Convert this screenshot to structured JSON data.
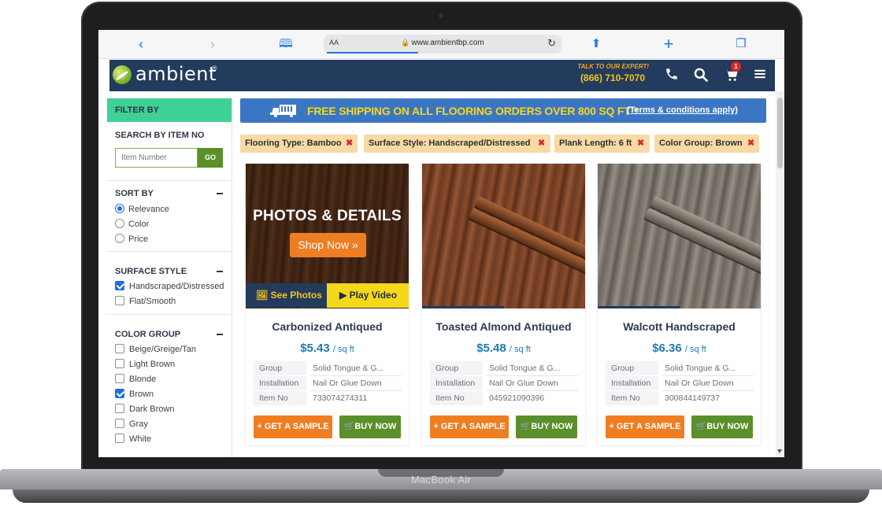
{
  "device": {
    "label": "MacBook Air"
  },
  "browser": {
    "url": "www.ambientbp.com",
    "aa_label": "AA"
  },
  "header": {
    "logo_text": "ambient",
    "logo_reg": "®",
    "expert_label": "TALK TO OUR EXPERT!",
    "phone": "(866) 710-7070",
    "cart_count": "1"
  },
  "sidebar": {
    "filter_title": "FILTER BY",
    "search": {
      "title": "SEARCH BY ITEM NO",
      "placeholder": "Item Number",
      "go_label": "GO"
    },
    "sort": {
      "title": "SORT BY",
      "options": [
        {
          "label": "Relevance",
          "selected": true
        },
        {
          "label": "Color",
          "selected": false
        },
        {
          "label": "Price",
          "selected": false
        }
      ]
    },
    "surface": {
      "title": "SURFACE STYLE",
      "options": [
        {
          "label": "Handscraped/Distressed",
          "checked": true
        },
        {
          "label": "Flat/Smooth",
          "checked": false
        }
      ]
    },
    "color": {
      "title": "COLOR GROUP",
      "options": [
        {
          "label": "Beige/Greige/Tan",
          "checked": false
        },
        {
          "label": "Light Brown",
          "checked": false
        },
        {
          "label": "Blonde",
          "checked": false
        },
        {
          "label": "Brown",
          "checked": true
        },
        {
          "label": "Dark Brown",
          "checked": false
        },
        {
          "label": "Gray",
          "checked": false
        },
        {
          "label": "White",
          "checked": false
        }
      ]
    }
  },
  "banner": {
    "text": "FREE SHIPPING ON ALL FLOORING ORDERS OVER 800 SQ FT *",
    "link": "(Terms & conditions apply)"
  },
  "chips": [
    {
      "label": "Flooring Type: Bamboo"
    },
    {
      "label": "Surface Style: Handscraped/Distressed"
    },
    {
      "label": "Plank Length: 6 ft"
    },
    {
      "label": "Color Group: Brown"
    }
  ],
  "promo": {
    "title": "PHOTOS & DETAILS",
    "shop_now": "Shop Now »",
    "see_photos": "See Photos",
    "play_video": "Play Video"
  },
  "products": [
    {
      "name": "Carbonized Antiqued",
      "price": "$5.43",
      "unit": "/ sq ft",
      "specs": [
        {
          "k": "Group",
          "v": "Solid Tongue & G..."
        },
        {
          "k": "Installation",
          "v": "Nail Or Glue Down"
        },
        {
          "k": "Item No",
          "v": "733074274311"
        }
      ],
      "sample_label": "+ GET A SAMPLE",
      "buy_label": "BUY NOW"
    },
    {
      "name": "Toasted Almond Antiqued",
      "price": "$5.48",
      "unit": "/ sq ft",
      "specs": [
        {
          "k": "Group",
          "v": "Solid Tongue & G..."
        },
        {
          "k": "Installation",
          "v": "Nail Or Glue Down"
        },
        {
          "k": "Item No",
          "v": "045921090396"
        }
      ],
      "sample_label": "+ GET A SAMPLE",
      "buy_label": "BUY NOW"
    },
    {
      "name": "Walcott Handscraped",
      "price": "$6.36",
      "unit": "/ sq ft",
      "specs": [
        {
          "k": "Group",
          "v": "Solid Tongue & G..."
        },
        {
          "k": "Installation",
          "v": "Nail Or Glue Down"
        },
        {
          "k": "Item No",
          "v": "300844149737"
        }
      ],
      "sample_label": "+ GET A SAMPLE",
      "buy_label": "BUY NOW"
    }
  ]
}
